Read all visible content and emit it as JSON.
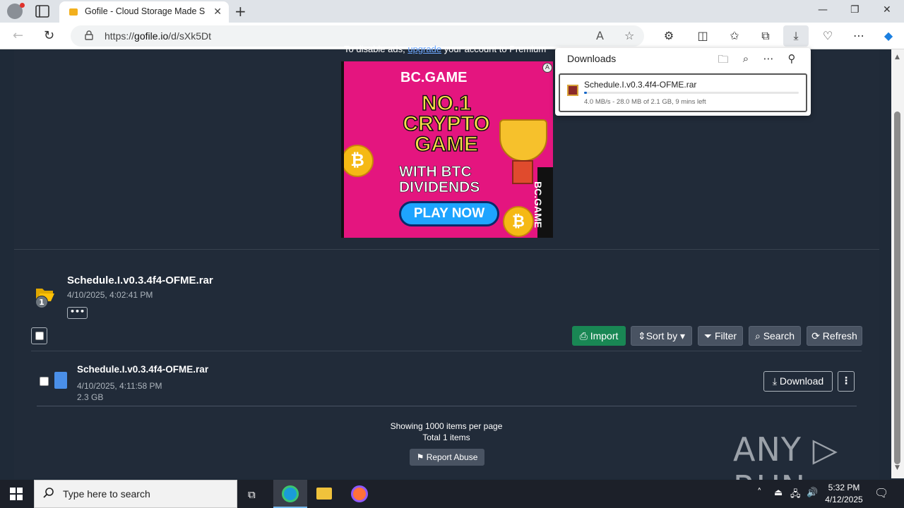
{
  "browser": {
    "tab_title": "Gofile - Cloud Storage Made Simple",
    "url_prefix": "https://",
    "url_host": "gofile.io",
    "url_path": "/d/sXk5Dt"
  },
  "ads": {
    "note_before": "To disable ads, ",
    "note_link": "upgrade",
    "note_after": " your account to Premium",
    "logo": "BC.GAME",
    "headline": "NO.1 CRYPTO GAME",
    "subline": "WITH BTC DIVIDENDS",
    "cta": "PLAY NOW",
    "side_text": "BC.GAME"
  },
  "folder": {
    "name": "Schedule.I.v0.3.4f4-OFME.rar",
    "date": "4/10/2025, 4:02:41 PM",
    "badge_count": "1",
    "more_label": "•••"
  },
  "toolbar": {
    "import_label": "Import",
    "sort_label": "Sort by",
    "filter_label": "Filter",
    "search_label": "Search",
    "refresh_label": "Refresh"
  },
  "files": [
    {
      "name": "Schedule.I.v0.3.4f4-OFME.rar",
      "date": "4/10/2025, 4:11:58 PM",
      "size": "2.3 GB",
      "download_label": "Download",
      "menu_label": "⋮"
    }
  ],
  "footer": {
    "per_page": "Showing 1000 items per page",
    "total": "Total 1 items",
    "report_label": "Report Abuse"
  },
  "downloads_panel": {
    "title": "Downloads",
    "item": {
      "filename": "Schedule.I.v0.3.4f4-OFME.rar",
      "status": "4.0 MB/s - 28.0 MB of 2.1 GB, 9 mins left",
      "progress_percent": 1.3
    }
  },
  "watermark": "ANY ▷ RUN",
  "taskbar": {
    "search_placeholder": "Type here to search",
    "time": "5:32 PM",
    "date": "4/12/2025"
  },
  "colors": {
    "page_bg": "#212b39",
    "import_green": "#198754",
    "button_gray": "#495362",
    "progress_blue": "#0b63c8"
  }
}
